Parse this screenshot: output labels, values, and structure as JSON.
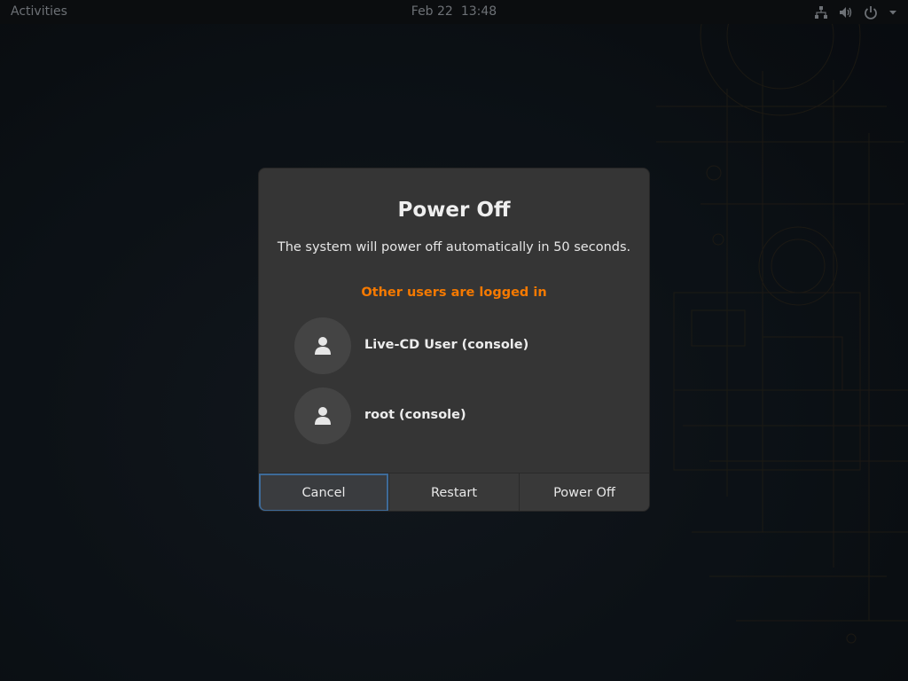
{
  "topbar": {
    "activities_label": "Activities",
    "date": "Feb 22",
    "time": "13:48",
    "tray_icons": [
      "network-icon",
      "volume-icon",
      "power-icon",
      "chevron-down-icon"
    ]
  },
  "dialog": {
    "title": "Power Off",
    "description": "The system will power off automatically in 50 seconds.",
    "warning": "Other users are logged in",
    "users": [
      {
        "name": "Live-CD User (console)",
        "icon": "user-icon"
      },
      {
        "name": "root (console)",
        "icon": "user-icon"
      }
    ],
    "buttons": {
      "cancel": "Cancel",
      "restart": "Restart",
      "power_off": "Power Off"
    }
  },
  "colors": {
    "warning": "#f57900",
    "dialog_bg": "#353535",
    "focus_ring": "#3e6b99",
    "topbar_bg": "#0b0d0f"
  }
}
